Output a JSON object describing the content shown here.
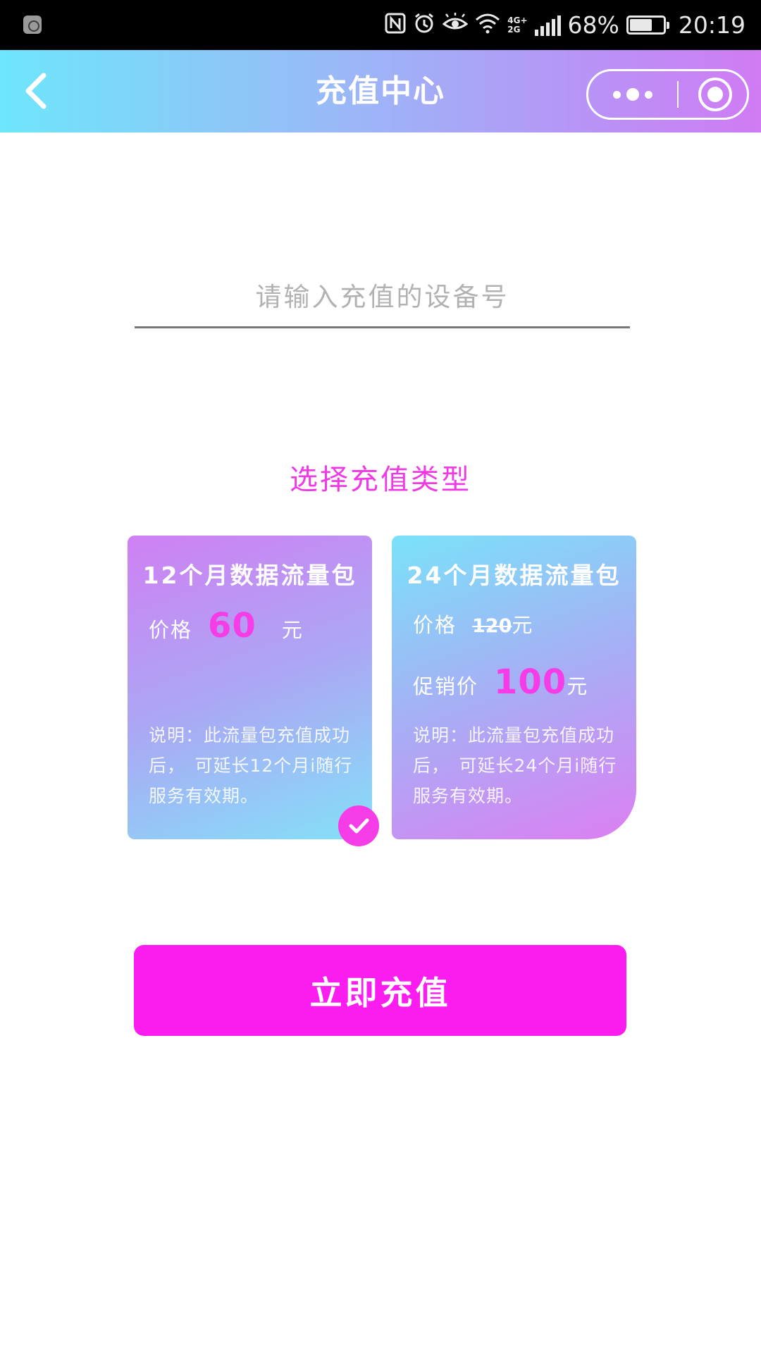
{
  "status_bar": {
    "battery_percent": "68%",
    "battery_level": 0.68,
    "time": "20:19",
    "network_type_top": "4G+",
    "network_type_bottom": "2G",
    "icons": [
      "nfc-icon",
      "alarm-icon",
      "eye-comfort-icon",
      "wifi-icon",
      "signal-icon",
      "battery-icon"
    ]
  },
  "nav": {
    "title": "充值中心",
    "back_icon": "chevron-left-icon",
    "more_icon": "more-dots-icon",
    "close_icon": "target-circle-icon"
  },
  "device_input": {
    "placeholder": "请输入充值的设备号",
    "value": ""
  },
  "section_title": "选择充值类型",
  "packages": [
    {
      "name": "12个月数据流量包",
      "price_label": "价格",
      "price": "60",
      "unit": "元",
      "description": "说明：此流量包充值成功后，　可延长12个月i随行服务有效期。",
      "selected": true
    },
    {
      "name": "24个月数据流量包",
      "price_label": "价格",
      "original_price": "120",
      "unit": "元",
      "promo_label": "促销价",
      "promo_price": "100",
      "description": "说明：此流量包充值成功后，　可延长24个月i随行服务有效期。",
      "selected": false
    }
  ],
  "submit_label": "立即充值",
  "colors": {
    "accent": "#fb1df0",
    "price": "#f53ce6",
    "section_title": "#ee39e4",
    "gradient_cyan": "#6ee6fb",
    "gradient_violet": "#d07bf4"
  }
}
